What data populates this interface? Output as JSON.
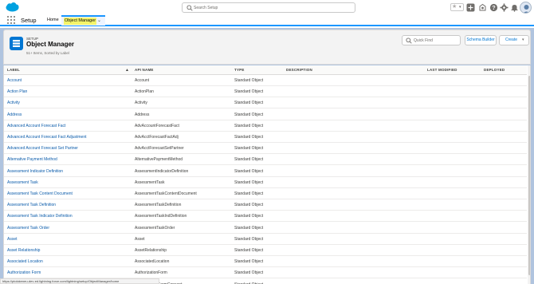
{
  "header": {
    "search_placeholder": "Search Setup",
    "icons": [
      "salesforce-cloud-logo",
      "search-icon",
      "favorites-star-icon",
      "chevron-down-icon",
      "add-icon",
      "trailhead-icon",
      "help-icon",
      "setup-gear-icon",
      "notifications-bell-icon",
      "avatar"
    ]
  },
  "context_bar": {
    "app_name": "Setup",
    "tabs": [
      {
        "label": "Home"
      },
      {
        "label": "Object Manager"
      }
    ]
  },
  "page_header": {
    "kicker": "SETUP",
    "title": "Object Manager",
    "subtitle": "51+ Items, Sorted by Label",
    "quick_find_placeholder": "Quick Find",
    "schema_builder_label": "Schema Builder",
    "create_label": "Create"
  },
  "table": {
    "columns": {
      "label": "LABEL",
      "api_name": "API NAME",
      "type": "TYPE",
      "description": "DESCRIPTION",
      "last_modified": "LAST MODIFIED",
      "deployed": "DEPLOYED"
    },
    "sort_indicator": "▲",
    "rows": [
      {
        "label": "Account",
        "api": "Account",
        "type": "Standard Object"
      },
      {
        "label": "Action Plan",
        "api": "ActionPlan",
        "type": "Standard Object"
      },
      {
        "label": "Activity",
        "api": "Activity",
        "type": "Standard Object"
      },
      {
        "label": "Address",
        "api": "Address",
        "type": "Standard Object"
      },
      {
        "label": "Advanced Account Forecast Fact",
        "api": "AdvAccountForecastFact",
        "type": "Standard Object"
      },
      {
        "label": "Advanced Account Forecast Fact Adjustment",
        "api": "AdvAcctForecastFactAdj",
        "type": "Standard Object"
      },
      {
        "label": "Advanced Account Forecast Set Partner",
        "api": "AdvAcctForecastSetPartner",
        "type": "Standard Object"
      },
      {
        "label": "Alternative Payment Method",
        "api": "AlternativePaymentMethod",
        "type": "Standard Object"
      },
      {
        "label": "Assessment Indicator Definition",
        "api": "AssessmentIndicatorDefinition",
        "type": "Standard Object"
      },
      {
        "label": "Assessment Task",
        "api": "AssessmentTask",
        "type": "Standard Object"
      },
      {
        "label": "Assessment Task Content Document",
        "api": "AssessmentTaskContentDocument",
        "type": "Standard Object"
      },
      {
        "label": "Assessment Task Definition",
        "api": "AssessmentTaskDefinition",
        "type": "Standard Object"
      },
      {
        "label": "Assessment Task Indicator Definition",
        "api": "AssessmentTaskIndDefinition",
        "type": "Standard Object"
      },
      {
        "label": "Assessment Task Order",
        "api": "AssessmentTaskOrder",
        "type": "Standard Object"
      },
      {
        "label": "Asset",
        "api": "Asset",
        "type": "Standard Object"
      },
      {
        "label": "Asset Relationship",
        "api": "AssetRelationship",
        "type": "Standard Object"
      },
      {
        "label": "Associated Location",
        "api": "AssociatedLocation",
        "type": "Standard Object"
      },
      {
        "label": "Authorization Form",
        "api": "AuthorizationForm",
        "type": "Standard Object"
      },
      {
        "label": "",
        "api": "AuthorizationFormConsent",
        "type": "Standard Object"
      }
    ]
  },
  "status_bar": {
    "url": "https://ptolokeneu-dev-ed.lightning.force.com/lightning/setup/ObjectManager/home"
  },
  "colors": {
    "brand": "#0176d3",
    "link": "#0b5cab",
    "page_background": "#b0c4df",
    "tab_highlight": "#f4f56b"
  }
}
